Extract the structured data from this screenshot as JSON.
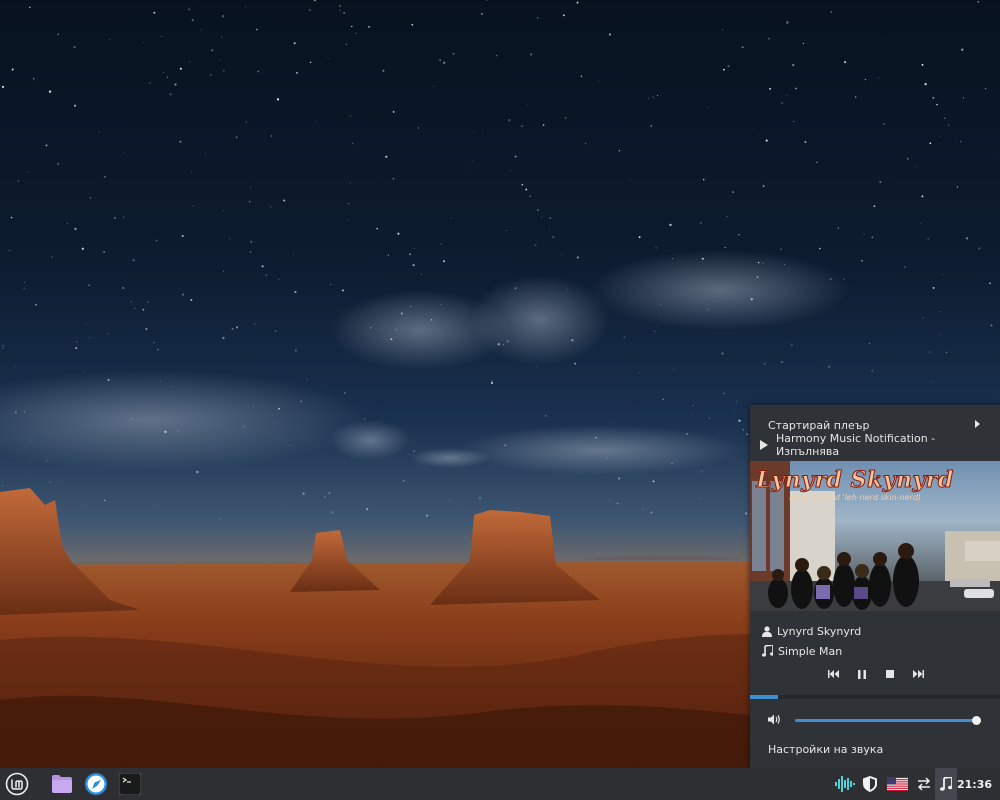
{
  "sound_menu": {
    "start_player_label": "Стартирай плеър",
    "now_playing_label": "Harmony Music Notification - Изпълнява",
    "album_art": {
      "band_name": "Lynyrd Skynyrd",
      "subtitle": "(pronounced 'leh-nerd skin-nerd)"
    },
    "artist": "Lynyrd Skynyrd",
    "title": "Simple Man",
    "controls": [
      "previous",
      "pause",
      "stop",
      "next"
    ],
    "track_progress": 0.11,
    "volume": 1.0,
    "sound_settings_label": "Настройки на звука"
  },
  "panel": {
    "launchers": [
      "linux-mint-menu-icon",
      "files-folder-icon",
      "web-browser-icon",
      "terminal-icon"
    ],
    "tray": [
      "audio-waveform-icon",
      "update-shield-icon",
      "keyboard-layout-us-flag-icon",
      "network-transfer-icon",
      "music-note-icon"
    ],
    "clock": "21:36"
  },
  "colors": {
    "accent": "#3d8fd1",
    "popup_bg": "#2f3237",
    "panel_bg": "#2d2f33",
    "tray_waveform": "#4fd1d9"
  }
}
